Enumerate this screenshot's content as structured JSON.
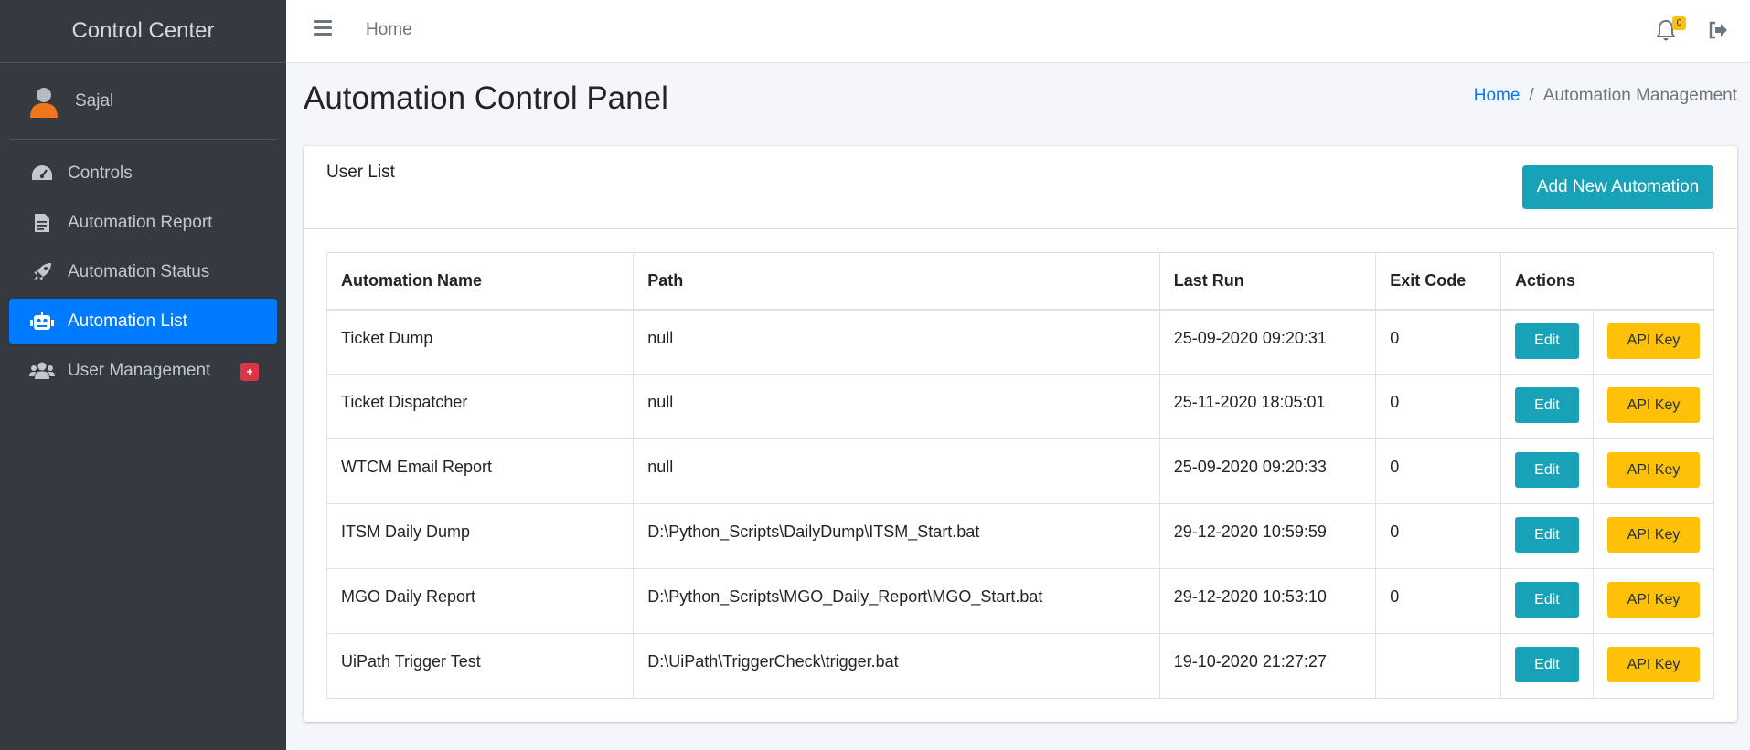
{
  "brand": "Control Center",
  "user": {
    "name": "Sajal",
    "icon": "user-avatar-icon"
  },
  "sidebar": {
    "items": [
      {
        "label": "Controls",
        "icon": "tachometer-icon",
        "active": false
      },
      {
        "label": "Automation Report",
        "icon": "file-report-icon",
        "active": false
      },
      {
        "label": "Automation Status",
        "icon": "rocket-icon",
        "active": false
      },
      {
        "label": "Automation List",
        "icon": "robot-icon",
        "active": true
      },
      {
        "label": "User Management",
        "icon": "users-icon",
        "active": false,
        "badge": "+"
      }
    ]
  },
  "topbar": {
    "home": "Home",
    "notification_count": "0",
    "icons": [
      "menu-icon",
      "bell-icon",
      "logout-icon"
    ]
  },
  "page": {
    "title": "Automation Control Panel",
    "breadcrumb": {
      "home": "Home",
      "separator": "/",
      "current": "Automation Management"
    }
  },
  "card": {
    "title": "User List",
    "add_button": "Add New Automation"
  },
  "table": {
    "headers": [
      "Automation Name",
      "Path",
      "Last Run",
      "Exit Code",
      "Actions"
    ],
    "edit_label": "Edit",
    "api_label": "API Key",
    "rows": [
      {
        "name": "Ticket Dump",
        "path": "null",
        "last_run": "25-09-2020 09:20:31",
        "exit_code": "0"
      },
      {
        "name": "Ticket Dispatcher",
        "path": "null",
        "last_run": "25-11-2020 18:05:01",
        "exit_code": "0"
      },
      {
        "name": "WTCM Email Report",
        "path": "null",
        "last_run": "25-09-2020 09:20:33",
        "exit_code": "0"
      },
      {
        "name": "ITSM Daily Dump",
        "path": "D:\\Python_Scripts\\DailyDump\\ITSM_Start.bat",
        "last_run": "29-12-2020 10:59:59",
        "exit_code": "0"
      },
      {
        "name": "MGO Daily Report",
        "path": "D:\\Python_Scripts\\MGO_Daily_Report\\MGO_Start.bat",
        "last_run": "29-12-2020 10:53:10",
        "exit_code": "0"
      },
      {
        "name": "UiPath Trigger Test",
        "path": "D:\\UiPath\\TriggerCheck\\trigger.bat",
        "last_run": "19-10-2020 21:27:27",
        "exit_code": ""
      }
    ]
  },
  "colors": {
    "sidebar_bg": "#343a40",
    "active_nav": "#007bff",
    "info_button": "#17a2b8",
    "warning_button": "#ffc107",
    "danger_badge": "#dc3545"
  }
}
